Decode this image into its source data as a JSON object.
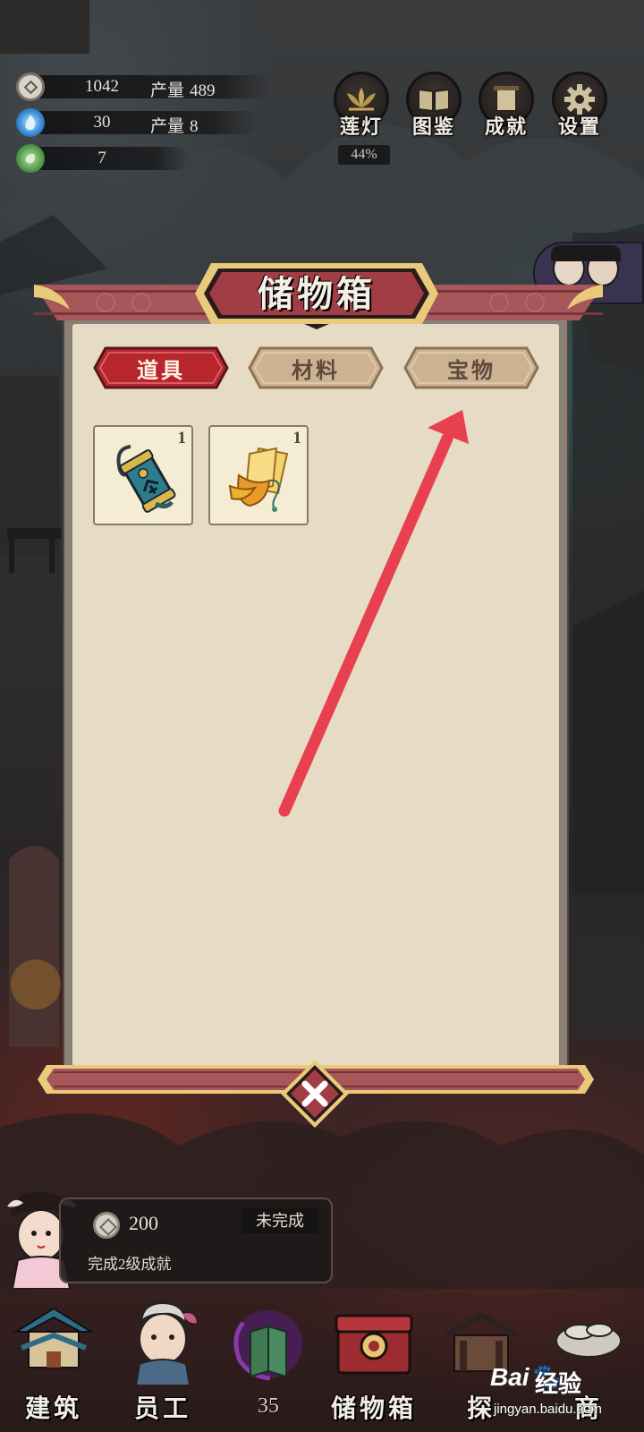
{
  "resources": [
    {
      "icon": "coin-icon",
      "value": "1042",
      "prod_label": "产量",
      "prod_value": "489"
    },
    {
      "icon": "blue-flame-icon",
      "value": "30",
      "prod_label": "产量",
      "prod_value": "8"
    },
    {
      "icon": "green-jade-icon",
      "value": "7"
    }
  ],
  "top_menu": {
    "lotus": {
      "label": "莲灯",
      "percent": "44%",
      "icon": "lotus-icon"
    },
    "codex": {
      "label": "图鉴",
      "icon": "book-icon"
    },
    "achievements": {
      "label": "成就",
      "icon": "scroll-icon"
    },
    "settings": {
      "label": "设置",
      "icon": "gear-icon"
    }
  },
  "storage": {
    "title": "储物箱",
    "tabs": [
      {
        "label": "道具",
        "active": true
      },
      {
        "label": "材料",
        "active": false
      },
      {
        "label": "宝物",
        "active": false
      }
    ],
    "items": [
      {
        "name": "command-token-item",
        "count": "1"
      },
      {
        "name": "talisman-item",
        "count": "1"
      }
    ]
  },
  "quest": {
    "reward": "200",
    "status": "未完成",
    "description": "完成2级成就"
  },
  "bottom_nav": [
    {
      "label": "建筑",
      "icon": "building-icon"
    },
    {
      "label": "员工",
      "icon": "staff-icon"
    },
    {
      "label": "",
      "count": "35",
      "icon": "spirit-book-icon"
    },
    {
      "label": "储物箱",
      "icon": "storage-chest-icon"
    },
    {
      "label": "探",
      "icon": "explore-icon"
    },
    {
      "label": "商",
      "icon": "shop-icon"
    }
  ],
  "watermark": {
    "brand": "Bai",
    "text": "经验",
    "url": "jingyan.baidu.com"
  },
  "colors": {
    "panel_bg": "#e6dbc4",
    "tab_active": "#b8292f",
    "tab_inactive": "#d2b99b",
    "banner": "#9a4a4e",
    "gold_trim": "#e9c97a",
    "arrow": "#e8404f"
  }
}
